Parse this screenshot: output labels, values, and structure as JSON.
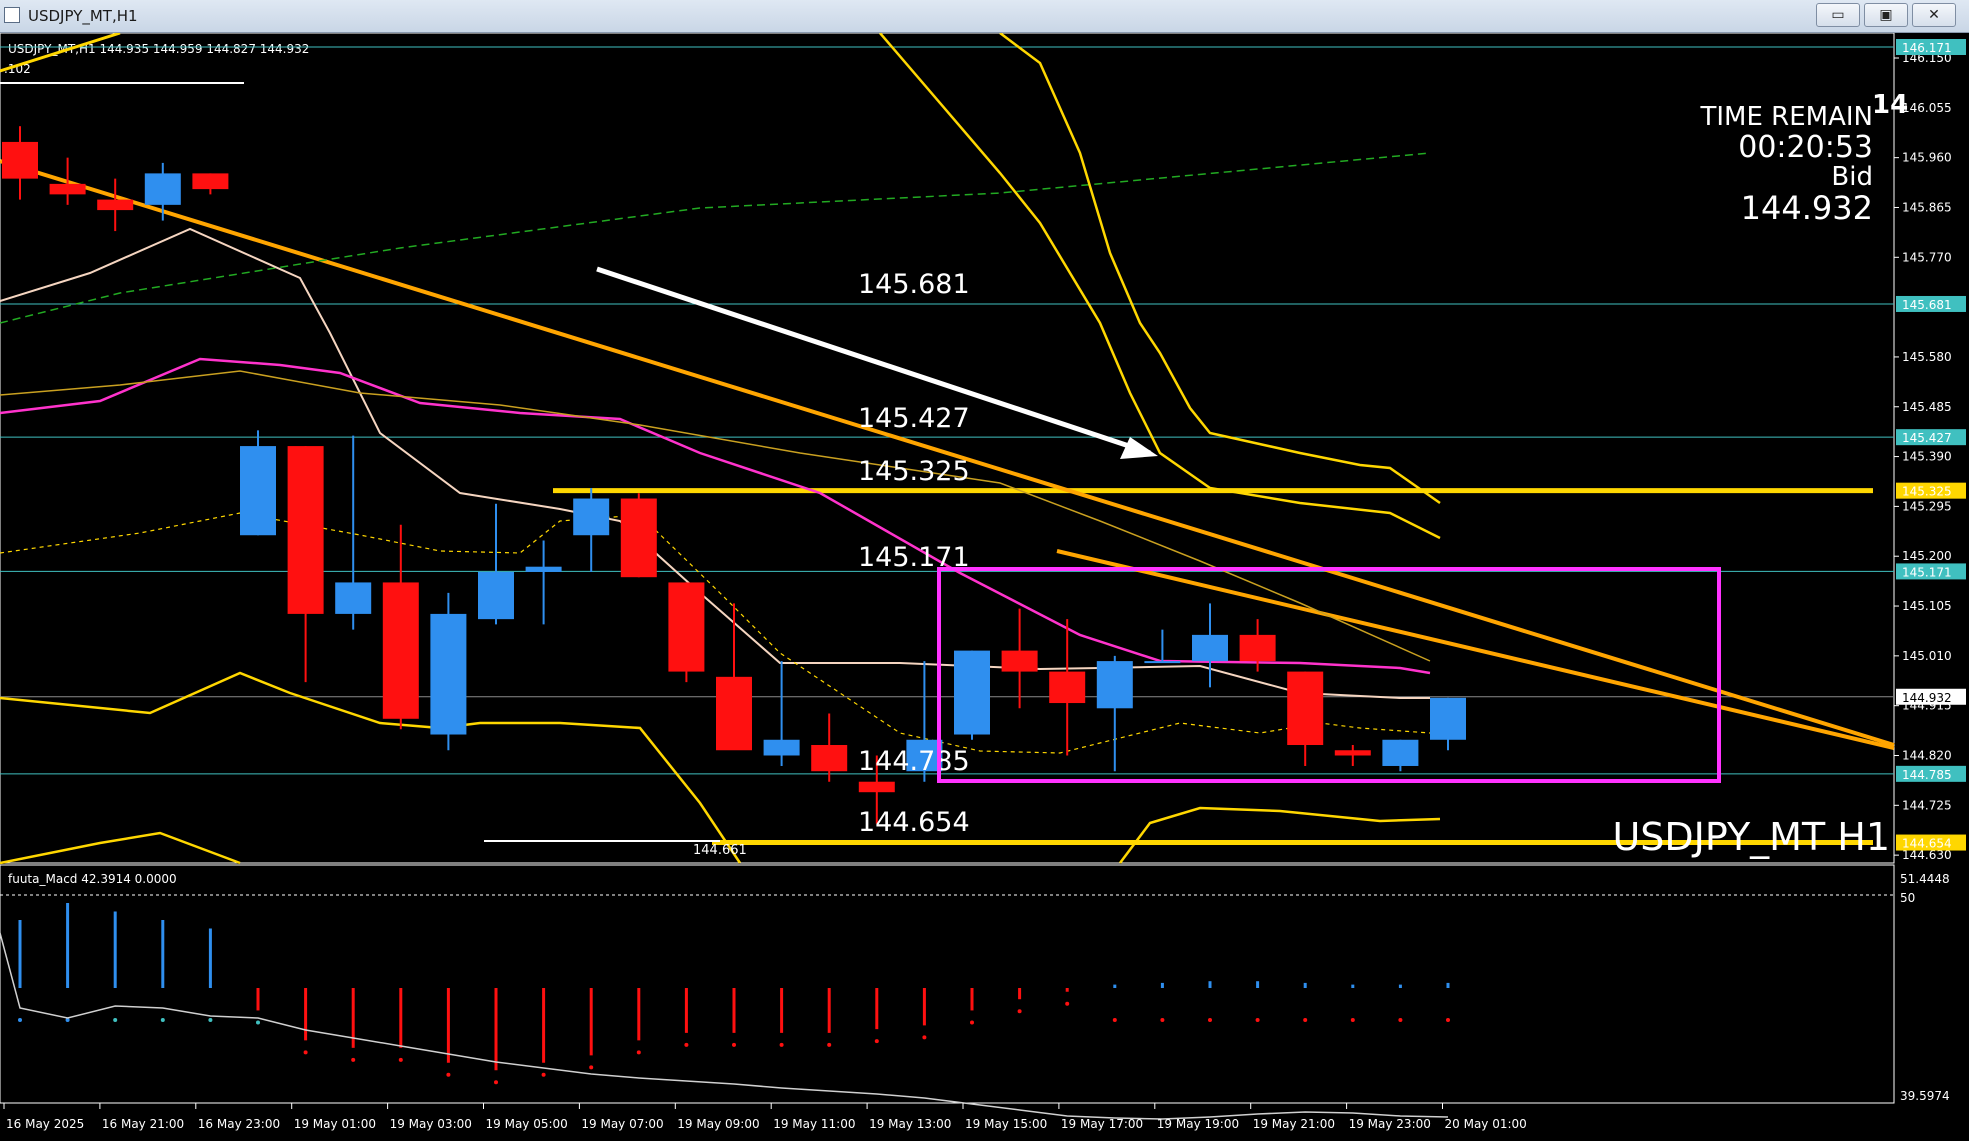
{
  "window": {
    "title": "USDJPY_MT,H1",
    "buttons": {
      "minimize": "▭",
      "restore": "▣",
      "close": "✕"
    }
  },
  "header": {
    "ohlc": "USDJPY_MT,H1  144.935 144.959 144.827 144.932",
    "sub": ".102"
  },
  "info": {
    "time_remain_label": "TIME REMAIN",
    "time_remain": "00:20:53",
    "bid_label": "Bid",
    "bid": "144.932",
    "partial": "14"
  },
  "watermark": "USDJPY_MT H1",
  "macd_label": "fuuta_Macd 42.3914   0.0000",
  "price_axis": {
    "labels": [
      "146.150",
      "146.055",
      "145.960",
      "145.865",
      "145.770",
      "145.580",
      "145.485",
      "145.390",
      "145.295",
      "145.200",
      "145.105",
      "145.010",
      "144.915",
      "144.820",
      "144.725",
      "144.630"
    ],
    "tags": [
      {
        "text": "146.171",
        "color": "#40c0c0",
        "price": 146.171
      },
      {
        "text": "145.681",
        "color": "#40c0c0",
        "price": 145.681
      },
      {
        "text": "145.427",
        "color": "#40c0c0",
        "price": 145.427
      },
      {
        "text": "145.325",
        "color": "#ffd700",
        "price": 145.325
      },
      {
        "text": "145.171",
        "color": "#40c0c0",
        "price": 145.171
      },
      {
        "text": "144.932",
        "color": "#ffffff",
        "price": 144.932
      },
      {
        "text": "144.785",
        "color": "#40c0c0",
        "price": 144.785
      },
      {
        "text": "144.654",
        "color": "#ffd700",
        "price": 144.654
      }
    ]
  },
  "macd_axis": {
    "top": "51.4448",
    "fifty": "50",
    "bottom": "39.5974"
  },
  "level_labels": [
    "145.681",
    "145.427",
    "145.325",
    "145.171",
    "144.785",
    "144.654"
  ],
  "low_label": "144.661",
  "time_axis": [
    "16 May 2025",
    "16 May 21:00",
    "16 May 23:00",
    "19 May 01:00",
    "19 May 03:00",
    "19 May 05:00",
    "19 May 07:00",
    "19 May 09:00",
    "19 May 11:00",
    "19 May 13:00",
    "19 May 15:00",
    "19 May 17:00",
    "19 May 19:00",
    "19 May 21:00",
    "19 May 23:00",
    "20 May 01:00"
  ],
  "chart_data": {
    "type": "candlestick",
    "price_range": [
      144.615,
      146.171
    ],
    "colors": {
      "bull": "#2f8fef",
      "bear": "#ff1010",
      "cyan": "#40c0c0",
      "yellow": "#ffd700",
      "magenta": "#ff33cc",
      "orange": "#ffa500"
    },
    "candles": [
      [
        145.99,
        146.02,
        145.88,
        145.92
      ],
      [
        145.91,
        145.96,
        145.87,
        145.89
      ],
      [
        145.88,
        145.92,
        145.82,
        145.86
      ],
      [
        145.87,
        145.95,
        145.84,
        145.93
      ],
      [
        145.93,
        145.93,
        145.89,
        145.9
      ],
      [
        145.24,
        145.44,
        145.24,
        145.41
      ],
      [
        145.41,
        145.41,
        144.96,
        145.09
      ],
      [
        145.09,
        145.43,
        145.06,
        145.15
      ],
      [
        145.15,
        145.26,
        144.87,
        144.89
      ],
      [
        144.86,
        145.13,
        144.83,
        145.09
      ],
      [
        145.08,
        145.3,
        145.07,
        145.17
      ],
      [
        145.17,
        145.23,
        145.07,
        145.18
      ],
      [
        145.24,
        145.33,
        145.17,
        145.31
      ],
      [
        145.31,
        145.32,
        145.16,
        145.16
      ],
      [
        145.15,
        145.15,
        144.96,
        144.98
      ],
      [
        144.97,
        145.11,
        144.84,
        144.83
      ],
      [
        144.82,
        145.0,
        144.8,
        144.85
      ],
      [
        144.84,
        144.9,
        144.77,
        144.79
      ],
      [
        144.77,
        144.82,
        144.69,
        144.75
      ],
      [
        144.79,
        145.0,
        144.77,
        144.85
      ],
      [
        144.86,
        145.02,
        144.85,
        145.02
      ],
      [
        145.02,
        145.1,
        144.91,
        144.98
      ],
      [
        144.98,
        145.08,
        144.82,
        144.92
      ],
      [
        144.91,
        145.01,
        144.79,
        145.0
      ],
      [
        145.0,
        145.06,
        145.0,
        145.0
      ],
      [
        145.0,
        145.11,
        144.95,
        145.05
      ],
      [
        145.05,
        145.08,
        144.98,
        145.0
      ],
      [
        144.98,
        144.98,
        144.8,
        144.84
      ],
      [
        144.83,
        144.84,
        144.8,
        144.82
      ],
      [
        144.8,
        144.85,
        144.79,
        144.85
      ],
      [
        144.85,
        144.93,
        144.83,
        144.93
      ]
    ],
    "macd_hist": [
      40,
      50,
      45,
      40,
      35,
      -6,
      -14,
      -16,
      -16,
      -20,
      -22,
      -20,
      -18,
      -14,
      -12,
      -12,
      -12,
      -12,
      -11,
      -10,
      -6,
      -3,
      -1,
      2,
      3,
      4,
      4,
      3,
      2,
      2,
      3
    ],
    "macd_signal": [
      -20,
      -30,
      -18,
      -20,
      -28,
      -30,
      -42,
      -50,
      -58,
      -66,
      -74,
      -80,
      -86,
      -90,
      -93,
      -96,
      -100,
      -103,
      -106,
      -110,
      -116,
      -122,
      -128,
      -130,
      -131,
      -129,
      -126,
      -124,
      -125,
      -128,
      -129
    ],
    "dot_colors": [
      "#2f8fef",
      "#2f8fef",
      "#40c0c0",
      "#40c0c0",
      "#40c0c0",
      "#40c0c0",
      "#ff1010",
      "#ff1010",
      "#ff1010",
      "#ff1010",
      "#ff1010",
      "#ff1010",
      "#ff1010",
      "#ff1010",
      "#ff1010",
      "#ff1010",
      "#ff1010",
      "#ff1010",
      "#ff1010",
      "#ff1010",
      "#ff1010",
      "#ff1010",
      "#ff1010",
      "#ff1010",
      "#ff1010",
      "#ff1010",
      "#ff1010",
      "#ff1010",
      "#ff1010",
      "#ff1010",
      "#ff1010"
    ]
  }
}
